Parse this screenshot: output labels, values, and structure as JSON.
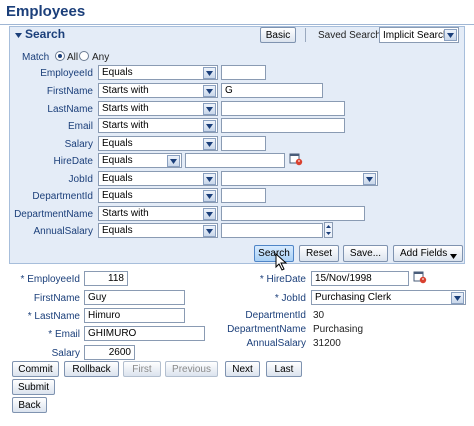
{
  "page": {
    "title": "Employees"
  },
  "search": {
    "title": "Search",
    "basic_label": "Basic",
    "saved_search_label": "Saved Search",
    "saved_search_value": "Implicit Search",
    "match_label": "Match",
    "match_all": "All",
    "match_any": "Any",
    "rows": [
      {
        "label": "EmployeeId",
        "operator": "Equals",
        "value": ""
      },
      {
        "label": "FirstName",
        "operator": "Starts with",
        "value": "G"
      },
      {
        "label": "LastName",
        "operator": "Starts with",
        "value": ""
      },
      {
        "label": "Email",
        "operator": "Starts with",
        "value": ""
      },
      {
        "label": "Salary",
        "operator": "Equals",
        "value": ""
      },
      {
        "label": "HireDate",
        "operator": "Equals",
        "value": ""
      },
      {
        "label": "JobId",
        "operator": "Equals",
        "value": ""
      },
      {
        "label": "DepartmentId",
        "operator": "Equals",
        "value": ""
      },
      {
        "label": "DepartmentName",
        "operator": "Starts with",
        "value": ""
      },
      {
        "label": "AnnualSalary",
        "operator": "Equals",
        "value": ""
      }
    ],
    "buttons": {
      "search": "Search",
      "reset": "Reset",
      "save": "Save...",
      "add_fields": "Add Fields"
    }
  },
  "form": {
    "employee_id_label": "EmployeeId",
    "employee_id": "118",
    "first_name_label": "FirstName",
    "first_name": "Guy",
    "last_name_label": "LastName",
    "last_name": "Himuro",
    "email_label": "Email",
    "email": "GHIMURO",
    "salary_label": "Salary",
    "salary": "2600",
    "hire_date_label": "HireDate",
    "hire_date": "15/Nov/1998",
    "job_id_label": "JobId",
    "job_id": "Purchasing Clerk",
    "department_id_label": "DepartmentId",
    "department_id": "30",
    "department_name_label": "DepartmentName",
    "department_name": "Purchasing",
    "annual_salary_label": "AnnualSalary",
    "annual_salary": "31200",
    "required_marker": "*"
  },
  "nav": {
    "commit": "Commit",
    "rollback": "Rollback",
    "first": "First",
    "previous": "Previous",
    "next": "Next",
    "last": "Last",
    "submit": "Submit",
    "back": "Back"
  },
  "colors": {
    "accent": "#1b3f7a",
    "panel": "#e4ecf7",
    "border": "#a7bedb"
  }
}
